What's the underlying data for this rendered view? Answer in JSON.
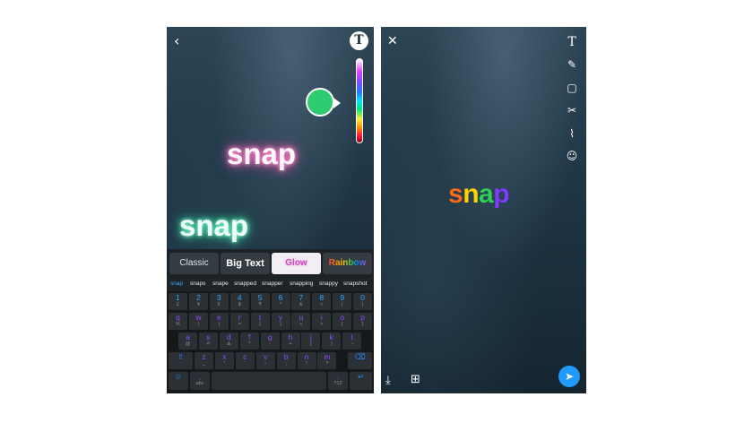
{
  "left_screen": {
    "back_icon": "chevron-left",
    "text_tool_label": "T",
    "picker_color": "#2ecc71",
    "captions": [
      "snap",
      "snap"
    ],
    "text_styles": [
      {
        "label": "Classic"
      },
      {
        "label": "Big Text"
      },
      {
        "label": "Glow"
      },
      {
        "label": "Rainbow"
      }
    ],
    "suggestions": [
      "snap",
      "snaps",
      "snape",
      "snapped",
      "snapper",
      "snapping",
      "snappy",
      "snapshot"
    ],
    "keyboard": {
      "number_row": [
        {
          "main": "1",
          "sub": "£"
        },
        {
          "main": "2",
          "sub": "¥"
        },
        {
          "main": "3",
          "sub": "€"
        },
        {
          "main": "4",
          "sub": "$"
        },
        {
          "main": "5",
          "sub": "₹"
        },
        {
          "main": "6",
          "sub": "^"
        },
        {
          "main": "7",
          "sub": "&"
        },
        {
          "main": "8",
          "sub": "<"
        },
        {
          "main": "9",
          "sub": "("
        },
        {
          "main": "0",
          "sub": ")"
        }
      ],
      "row1": [
        {
          "main": "q",
          "sub": "%"
        },
        {
          "main": "w",
          "sub": "\\"
        },
        {
          "main": "e",
          "sub": "|"
        },
        {
          "main": "r",
          "sub": "="
        },
        {
          "main": "t",
          "sub": "["
        },
        {
          "main": "y",
          "sub": "]"
        },
        {
          "main": "u",
          "sub": "<"
        },
        {
          "main": "i",
          "sub": ">"
        },
        {
          "main": "o",
          "sub": "{"
        },
        {
          "main": "p",
          "sub": "}"
        }
      ],
      "row2": [
        {
          "main": "a",
          "sub": "@"
        },
        {
          "main": "s",
          "sub": "#"
        },
        {
          "main": "d",
          "sub": "&"
        },
        {
          "main": "f",
          "sub": "*"
        },
        {
          "main": "g",
          "sub": "-"
        },
        {
          "main": "h",
          "sub": "+"
        },
        {
          "main": "j",
          "sub": "("
        },
        {
          "main": "k",
          "sub": ")"
        },
        {
          "main": "l",
          "sub": "~"
        }
      ],
      "row3": [
        {
          "main": "z",
          "sub": "_"
        },
        {
          "main": "x",
          "sub": "\""
        },
        {
          "main": "c",
          "sub": "'"
        },
        {
          "main": "v",
          "sub": ":"
        },
        {
          "main": "b",
          "sub": ";"
        },
        {
          "main": "n",
          "sub": "!"
        },
        {
          "main": "m",
          "sub": "?"
        }
      ],
      "shift_icon": "shift-arrow",
      "backspace_icon": "backspace",
      "bottom_row": {
        "symbols": "☺",
        "left_sub": "abc",
        "comma": ",",
        "space": "",
        "period": ".",
        "right_sub": "?12",
        "enter": "↵"
      }
    }
  },
  "right_screen": {
    "close_icon": "close-x",
    "tools": [
      "T",
      "pencil",
      "sticker",
      "scissors",
      "paperclip",
      "lens"
    ],
    "caption_letters": [
      "s",
      "n",
      "a",
      "p"
    ],
    "caption_colors": [
      "#ff6a1a",
      "#ffd400",
      "#2fd158",
      "#7d3cff"
    ],
    "save_icon": "download",
    "story_icon": "add-story",
    "send_icon": "send-arrow",
    "send_color": "#1f9bff"
  }
}
